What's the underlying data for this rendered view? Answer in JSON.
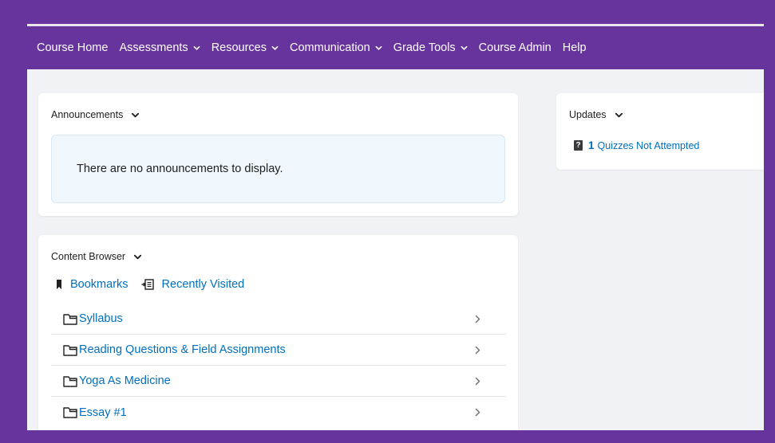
{
  "nav": {
    "items": [
      {
        "label": "Course Home",
        "dropdown": false
      },
      {
        "label": "Assessments",
        "dropdown": true
      },
      {
        "label": "Resources",
        "dropdown": true
      },
      {
        "label": "Communication",
        "dropdown": true
      },
      {
        "label": "Grade Tools",
        "dropdown": true
      },
      {
        "label": "Course Admin",
        "dropdown": false
      },
      {
        "label": "Help",
        "dropdown": false
      }
    ]
  },
  "announcements": {
    "title": "Announcements",
    "empty_message": "There are no announcements to display."
  },
  "content_browser": {
    "title": "Content Browser",
    "bookmarks_label": "Bookmarks",
    "recently_visited_label": "Recently Visited",
    "items": [
      {
        "label": "Syllabus"
      },
      {
        "label": "Reading Questions & Field Assignments"
      },
      {
        "label": "Yoga As Medicine"
      },
      {
        "label": "Essay #1"
      }
    ]
  },
  "updates": {
    "title": "Updates",
    "icon_glyph": "?",
    "count": "1",
    "text": "Quizzes Not Attempted"
  },
  "colors": {
    "brand": "#67339c",
    "link": "#006fbf",
    "background": "#f1f2f5"
  }
}
